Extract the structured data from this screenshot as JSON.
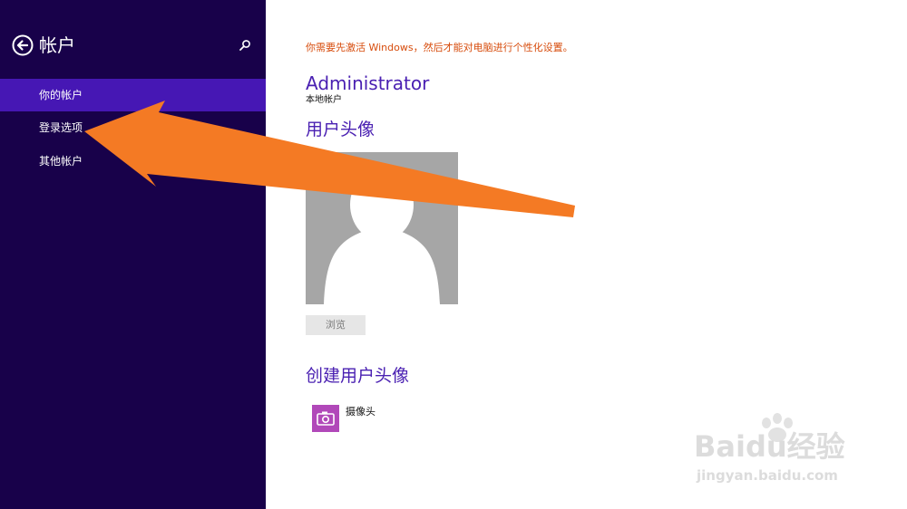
{
  "sidebar": {
    "title": "帐户",
    "items": [
      {
        "label": "你的帐户",
        "selected": true
      },
      {
        "label": "登录选项",
        "selected": false
      },
      {
        "label": "其他帐户",
        "selected": false
      }
    ]
  },
  "main": {
    "warning": "你需要先激活 Windows，然后才能对电脑进行个性化设置。",
    "user_name": "Administrator",
    "account_type": "本地帐户",
    "avatar_section_title": "用户头像",
    "browse_button": "浏览",
    "create_section_title": "创建用户头像",
    "camera_label": "摄像头"
  },
  "watermark": {
    "logo_text": "Baidu经验",
    "url": "jingyan.baidu.com"
  },
  "colors": {
    "sidebar_bg": "#18014a",
    "selected_item_bg": "#4617b4",
    "accent_text": "#4a20b2",
    "warning_text": "#d74c0c",
    "annotation_arrow": "#f47a24",
    "camera_tile": "#b148b9"
  },
  "icons": {
    "back": "back-arrow-circle-icon",
    "search": "search-icon",
    "avatar": "user-silhouette-icon",
    "camera": "camera-icon"
  }
}
